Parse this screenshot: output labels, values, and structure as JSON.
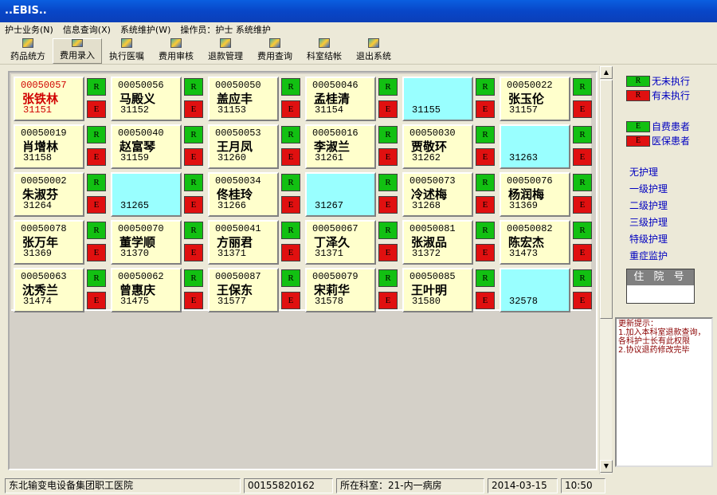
{
  "window": {
    "title": "..EBIS.."
  },
  "menu": [
    "护士业务(N)",
    "信息查询(X)",
    "系统维护(W)",
    "操作员：护士 系统维护"
  ],
  "toolbar": [
    {
      "label": "药品统方",
      "icon": "medicine-icon"
    },
    {
      "label": "费用录入",
      "icon": "fee-entry-icon",
      "active": true
    },
    {
      "label": "执行医嘱",
      "icon": "order-icon"
    },
    {
      "label": "费用审核",
      "icon": "audit-icon"
    },
    {
      "label": "退款管理",
      "icon": "refund-icon"
    },
    {
      "label": "费用查询",
      "icon": "query-icon"
    },
    {
      "label": "科室结帐",
      "icon": "settle-icon"
    },
    {
      "label": "退出系统",
      "icon": "exit-icon"
    }
  ],
  "button_labels": {
    "r": "R",
    "e": "E"
  },
  "patients": [
    {
      "id": "00050057",
      "name": "张铁林",
      "bed": "31151",
      "style": "red"
    },
    {
      "id": "00050056",
      "name": "马殿义",
      "bed": "31152"
    },
    {
      "id": "00050050",
      "name": "盖应丰",
      "bed": "31153"
    },
    {
      "id": "00050046",
      "name": "孟桂清",
      "bed": "31154"
    },
    {
      "id": "",
      "name": "",
      "bed": "31155",
      "style": "empty"
    },
    {
      "id": "00050022",
      "name": "张玉伦",
      "bed": "31157"
    },
    {
      "id": "00050019",
      "name": "肖增林",
      "bed": "31158"
    },
    {
      "id": "00050040",
      "name": "赵富琴",
      "bed": "31159"
    },
    {
      "id": "00050053",
      "name": "王月凤",
      "bed": "31260"
    },
    {
      "id": "00050016",
      "name": "李淑兰",
      "bed": "31261"
    },
    {
      "id": "00050030",
      "name": "贾敬环",
      "bed": "31262"
    },
    {
      "id": "",
      "name": "",
      "bed": "31263",
      "style": "empty"
    },
    {
      "id": "00050002",
      "name": "朱淑芬",
      "bed": "31264"
    },
    {
      "id": "",
      "name": "",
      "bed": "31265",
      "style": "empty"
    },
    {
      "id": "00050034",
      "name": "佟桂玲",
      "bed": "31266"
    },
    {
      "id": "",
      "name": "",
      "bed": "31267",
      "style": "empty"
    },
    {
      "id": "00050073",
      "name": "冷述梅",
      "bed": "31268"
    },
    {
      "id": "00050076",
      "name": "杨润梅",
      "bed": "31369"
    },
    {
      "id": "00050078",
      "name": "张万年",
      "bed": "31369"
    },
    {
      "id": "00050070",
      "name": "董学顺",
      "bed": "31370"
    },
    {
      "id": "00050041",
      "name": "方丽君",
      "bed": "31371"
    },
    {
      "id": "00050067",
      "name": "丁泽久",
      "bed": "31371"
    },
    {
      "id": "00050081",
      "name": "张淑品",
      "bed": "31372"
    },
    {
      "id": "00050082",
      "name": "陈宏杰",
      "bed": "31473"
    },
    {
      "id": "00050063",
      "name": "沈秀兰",
      "bed": "31474"
    },
    {
      "id": "00050062",
      "name": "曾惠庆",
      "bed": "31475"
    },
    {
      "id": "00050087",
      "name": "王保东",
      "bed": "31577"
    },
    {
      "id": "00050079",
      "name": "宋莉华",
      "bed": "31578"
    },
    {
      "id": "00050085",
      "name": "王叶明",
      "bed": "31580"
    },
    {
      "id": "",
      "name": "",
      "bed": "32578",
      "style": "empty"
    }
  ],
  "legend": {
    "exec": [
      {
        "swatch": "R",
        "color": "#12C012",
        "label": "无未执行"
      },
      {
        "swatch": "R",
        "color": "#E01010",
        "label": "有未执行"
      }
    ],
    "payer": [
      {
        "swatch": "E",
        "color": "#12C012",
        "label": "自费患者"
      },
      {
        "swatch": "E",
        "color": "#E01010",
        "label": "医保患者"
      }
    ],
    "care": [
      {
        "color": "#99FFFF",
        "label": "无护理"
      },
      {
        "color": "#F4C7C3",
        "label": "一级护理"
      },
      {
        "color": "#FFFFCC",
        "label": "二级护理"
      },
      {
        "color": "#CCFFCC",
        "label": "三级护理"
      },
      {
        "color": "#FFCCFF",
        "label": "特级护理"
      },
      {
        "color": "#8C8CFF",
        "label": "重症监护"
      }
    ],
    "admission_header": "住 院 号",
    "admission_value": ""
  },
  "notes": {
    "title": "更新提示：",
    "lines": [
      "1.加入本科室退款查询，各科护士长有此权限",
      "2.协议退药修改完毕"
    ]
  },
  "status": {
    "hospital": "东北输变电设备集团职工医院",
    "code": "00155820162",
    "department": "所在科室：21-内一病房",
    "date": "2014-03-15",
    "time": "10:50"
  }
}
